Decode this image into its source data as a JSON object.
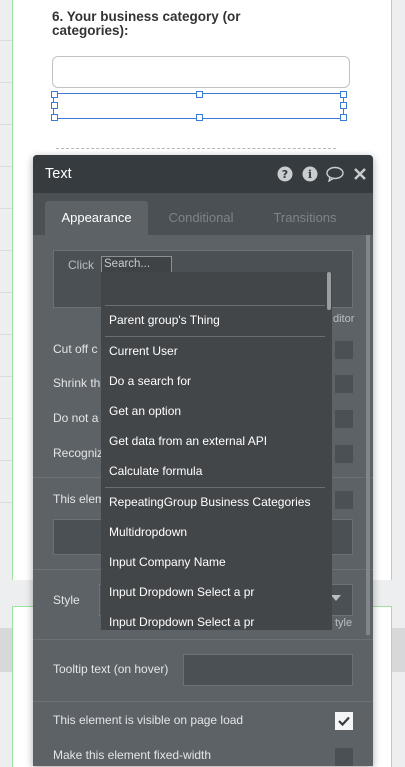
{
  "form": {
    "question_label": "6.  Your business category (or categories):"
  },
  "panel": {
    "title": "Text",
    "tabs": [
      {
        "label": "Appearance",
        "active": true
      },
      {
        "label": "Conditional",
        "active": false
      },
      {
        "label": "Transitions",
        "active": false
      }
    ],
    "click_prefix": "Click",
    "search_placeholder": "Search...",
    "editor_suffix": "ditor",
    "style_label": "Style",
    "style_suffix": "tyle",
    "rows": {
      "cut_off": "Cut off c",
      "shrink": "Shrink th",
      "do_not": "Do not a",
      "recognize": "Recogniz",
      "this_elem": "This elem"
    },
    "tooltip_label": "Tooltip text (on hover)",
    "visible_on_load": "This element is visible on page load",
    "visible_checked": true,
    "fixed_width": "Make this element fixed-width"
  },
  "dropdown": {
    "items": [
      "Parent group's Thing",
      "Current User",
      "Do a search for",
      "Get an option",
      "Get data from an external API",
      "Calculate formula",
      "RepeatingGroup Business Categories",
      "Multidropdown",
      "Input Company Name",
      "Input Dropdown Select a pr",
      "Input Dropdown Select a pr"
    ]
  },
  "colors": {
    "panel_bg": "#5d6266",
    "header_bg": "#353b3f",
    "dropdown_bg": "#434649",
    "selection": "#3b7bd6"
  }
}
